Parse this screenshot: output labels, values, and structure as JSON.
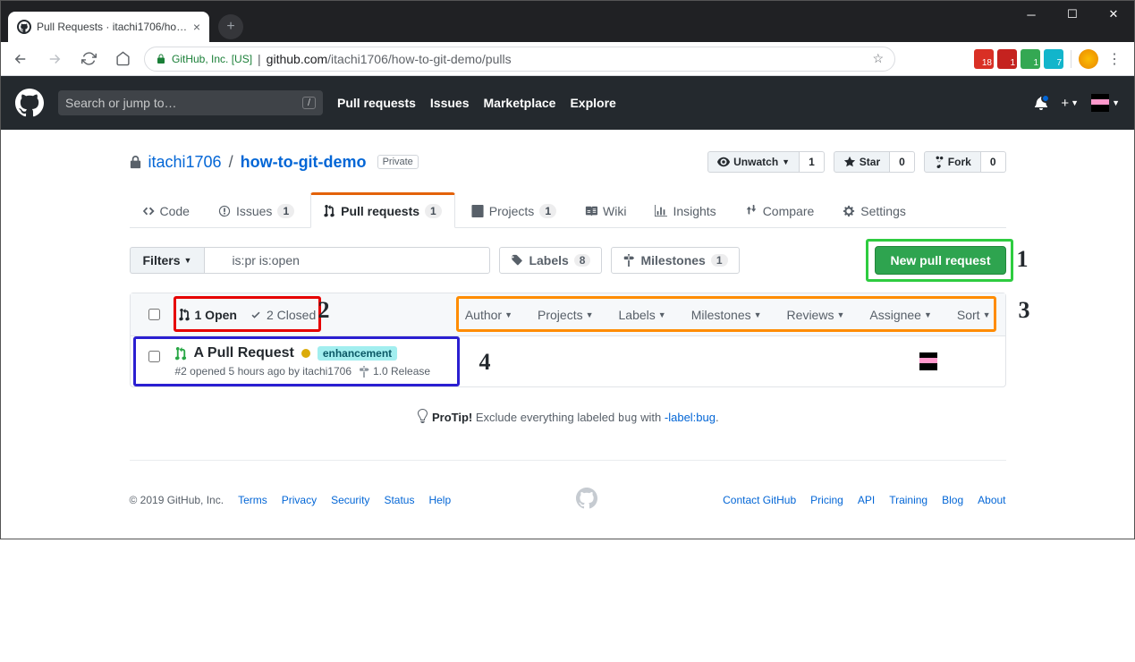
{
  "browser": {
    "tab_title": "Pull Requests · itachi1706/how-to…",
    "secure_label": "GitHub, Inc. [US]",
    "url_host": "github.com",
    "url_path": "/itachi1706/how-to-git-demo/pulls"
  },
  "github_header": {
    "search_placeholder": "Search or jump to…",
    "nav": {
      "pulls": "Pull requests",
      "issues": "Issues",
      "marketplace": "Marketplace",
      "explore": "Explore"
    }
  },
  "repo": {
    "owner": "itachi1706",
    "name": "how-to-git-demo",
    "visibility": "Private",
    "actions": {
      "unwatch": "Unwatch",
      "unwatch_count": "1",
      "star": "Star",
      "star_count": "0",
      "fork": "Fork",
      "fork_count": "0"
    },
    "tabs": {
      "code": "Code",
      "issues": "Issues",
      "issues_count": "1",
      "pulls": "Pull requests",
      "pulls_count": "1",
      "projects": "Projects",
      "projects_count": "1",
      "wiki": "Wiki",
      "insights": "Insights",
      "compare": "Compare",
      "settings": "Settings"
    }
  },
  "subnav": {
    "filters_label": "Filters",
    "search_value": "is:pr is:open",
    "labels": "Labels",
    "labels_count": "8",
    "milestones": "Milestones",
    "milestones_count": "1",
    "new_pr": "New pull request"
  },
  "list": {
    "open_label": "1 Open",
    "closed_label": "2 Closed",
    "filters": {
      "author": "Author",
      "projects": "Projects",
      "labels": "Labels",
      "milestones": "Milestones",
      "reviews": "Reviews",
      "assignee": "Assignee",
      "sort": "Sort"
    },
    "items": [
      {
        "title": "A Pull Request",
        "label": "enhancement",
        "subtext": "#2 opened 5 hours ago by itachi1706",
        "milestone": "1.0 Release"
      }
    ]
  },
  "protip": {
    "lead": "ProTip!",
    "text_a": " Exclude everything labeled ",
    "code": "bug",
    "text_b": " with ",
    "link": "-label:bug"
  },
  "footer": {
    "copyright": "© 2019 GitHub, Inc.",
    "left": {
      "terms": "Terms",
      "privacy": "Privacy",
      "security": "Security",
      "status": "Status",
      "help": "Help"
    },
    "right": {
      "contact": "Contact GitHub",
      "pricing": "Pricing",
      "api": "API",
      "training": "Training",
      "blog": "Blog",
      "about": "About"
    }
  },
  "annotations": {
    "n1": "1",
    "n2": "2",
    "n3": "3",
    "n4": "4"
  }
}
